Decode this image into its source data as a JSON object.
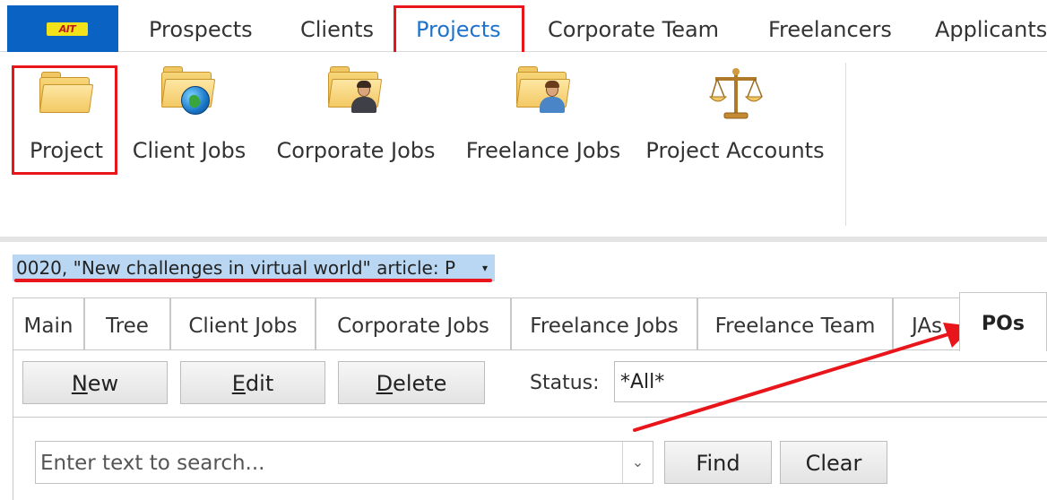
{
  "menubar": {
    "logo_text": "AIT",
    "tabs": [
      {
        "label": "Prospects"
      },
      {
        "label": "Clients"
      },
      {
        "label": "Projects"
      },
      {
        "label": "Corporate Team"
      },
      {
        "label": "Freelancers"
      },
      {
        "label": "Applicants"
      }
    ],
    "active_tab": "Projects"
  },
  "ribbon": {
    "buttons": [
      {
        "label": "Project",
        "icon": "folder-icon"
      },
      {
        "label": "Client Jobs",
        "icon": "folder-globe-icon"
      },
      {
        "label": "Corporate Jobs",
        "icon": "folder-person-icon"
      },
      {
        "label": "Freelance Jobs",
        "icon": "folder-person-blue-icon"
      },
      {
        "label": "Project Accounts",
        "icon": "scales-icon"
      }
    ]
  },
  "record_selector": {
    "value": "0020, \"New challenges in virtual world\" article: P",
    "caret": "▾"
  },
  "tabs": [
    {
      "label": "Main"
    },
    {
      "label": "Tree"
    },
    {
      "label": "Client Jobs"
    },
    {
      "label": "Corporate Jobs"
    },
    {
      "label": "Freelance Jobs"
    },
    {
      "label": "Freelance Team"
    },
    {
      "label": "JAs"
    },
    {
      "label": "POs"
    }
  ],
  "active_tab": "POs",
  "toolbar": {
    "new_label_u": "N",
    "new_label_rest": "ew",
    "edit_label_u": "E",
    "edit_label_rest": "dit",
    "delete_label_u": "D",
    "delete_label_rest": "elete",
    "status_label": "Status:",
    "status_value": "*All*"
  },
  "search": {
    "placeholder": "Enter text to search...",
    "dropdown_glyph": "⌄",
    "find_label": "Find",
    "clear_label": "Clear"
  },
  "colors": {
    "accent": "#1f73cc",
    "app_button": "#0a63c2",
    "highlight": "#e8151b",
    "record_bg": "#b9d7f2"
  }
}
